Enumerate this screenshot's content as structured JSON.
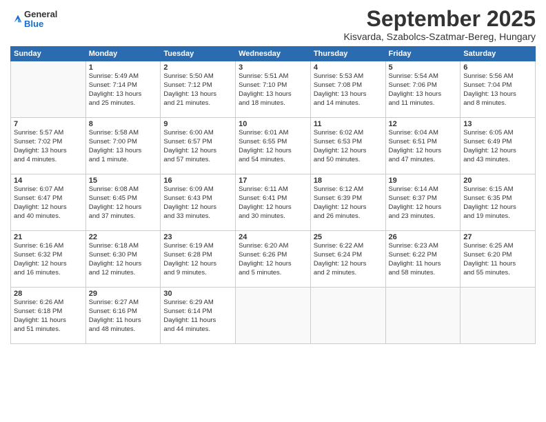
{
  "logo": {
    "general": "General",
    "blue": "Blue"
  },
  "title": "September 2025",
  "location": "Kisvarda, Szabolcs-Szatmar-Bereg, Hungary",
  "headers": [
    "Sunday",
    "Monday",
    "Tuesday",
    "Wednesday",
    "Thursday",
    "Friday",
    "Saturday"
  ],
  "weeks": [
    [
      {
        "day": "",
        "info": ""
      },
      {
        "day": "1",
        "info": "Sunrise: 5:49 AM\nSunset: 7:14 PM\nDaylight: 13 hours\nand 25 minutes."
      },
      {
        "day": "2",
        "info": "Sunrise: 5:50 AM\nSunset: 7:12 PM\nDaylight: 13 hours\nand 21 minutes."
      },
      {
        "day": "3",
        "info": "Sunrise: 5:51 AM\nSunset: 7:10 PM\nDaylight: 13 hours\nand 18 minutes."
      },
      {
        "day": "4",
        "info": "Sunrise: 5:53 AM\nSunset: 7:08 PM\nDaylight: 13 hours\nand 14 minutes."
      },
      {
        "day": "5",
        "info": "Sunrise: 5:54 AM\nSunset: 7:06 PM\nDaylight: 13 hours\nand 11 minutes."
      },
      {
        "day": "6",
        "info": "Sunrise: 5:56 AM\nSunset: 7:04 PM\nDaylight: 13 hours\nand 8 minutes."
      }
    ],
    [
      {
        "day": "7",
        "info": "Sunrise: 5:57 AM\nSunset: 7:02 PM\nDaylight: 13 hours\nand 4 minutes."
      },
      {
        "day": "8",
        "info": "Sunrise: 5:58 AM\nSunset: 7:00 PM\nDaylight: 13 hours\nand 1 minute."
      },
      {
        "day": "9",
        "info": "Sunrise: 6:00 AM\nSunset: 6:57 PM\nDaylight: 12 hours\nand 57 minutes."
      },
      {
        "day": "10",
        "info": "Sunrise: 6:01 AM\nSunset: 6:55 PM\nDaylight: 12 hours\nand 54 minutes."
      },
      {
        "day": "11",
        "info": "Sunrise: 6:02 AM\nSunset: 6:53 PM\nDaylight: 12 hours\nand 50 minutes."
      },
      {
        "day": "12",
        "info": "Sunrise: 6:04 AM\nSunset: 6:51 PM\nDaylight: 12 hours\nand 47 minutes."
      },
      {
        "day": "13",
        "info": "Sunrise: 6:05 AM\nSunset: 6:49 PM\nDaylight: 12 hours\nand 43 minutes."
      }
    ],
    [
      {
        "day": "14",
        "info": "Sunrise: 6:07 AM\nSunset: 6:47 PM\nDaylight: 12 hours\nand 40 minutes."
      },
      {
        "day": "15",
        "info": "Sunrise: 6:08 AM\nSunset: 6:45 PM\nDaylight: 12 hours\nand 37 minutes."
      },
      {
        "day": "16",
        "info": "Sunrise: 6:09 AM\nSunset: 6:43 PM\nDaylight: 12 hours\nand 33 minutes."
      },
      {
        "day": "17",
        "info": "Sunrise: 6:11 AM\nSunset: 6:41 PM\nDaylight: 12 hours\nand 30 minutes."
      },
      {
        "day": "18",
        "info": "Sunrise: 6:12 AM\nSunset: 6:39 PM\nDaylight: 12 hours\nand 26 minutes."
      },
      {
        "day": "19",
        "info": "Sunrise: 6:14 AM\nSunset: 6:37 PM\nDaylight: 12 hours\nand 23 minutes."
      },
      {
        "day": "20",
        "info": "Sunrise: 6:15 AM\nSunset: 6:35 PM\nDaylight: 12 hours\nand 19 minutes."
      }
    ],
    [
      {
        "day": "21",
        "info": "Sunrise: 6:16 AM\nSunset: 6:32 PM\nDaylight: 12 hours\nand 16 minutes."
      },
      {
        "day": "22",
        "info": "Sunrise: 6:18 AM\nSunset: 6:30 PM\nDaylight: 12 hours\nand 12 minutes."
      },
      {
        "day": "23",
        "info": "Sunrise: 6:19 AM\nSunset: 6:28 PM\nDaylight: 12 hours\nand 9 minutes."
      },
      {
        "day": "24",
        "info": "Sunrise: 6:20 AM\nSunset: 6:26 PM\nDaylight: 12 hours\nand 5 minutes."
      },
      {
        "day": "25",
        "info": "Sunrise: 6:22 AM\nSunset: 6:24 PM\nDaylight: 12 hours\nand 2 minutes."
      },
      {
        "day": "26",
        "info": "Sunrise: 6:23 AM\nSunset: 6:22 PM\nDaylight: 11 hours\nand 58 minutes."
      },
      {
        "day": "27",
        "info": "Sunrise: 6:25 AM\nSunset: 6:20 PM\nDaylight: 11 hours\nand 55 minutes."
      }
    ],
    [
      {
        "day": "28",
        "info": "Sunrise: 6:26 AM\nSunset: 6:18 PM\nDaylight: 11 hours\nand 51 minutes."
      },
      {
        "day": "29",
        "info": "Sunrise: 6:27 AM\nSunset: 6:16 PM\nDaylight: 11 hours\nand 48 minutes."
      },
      {
        "day": "30",
        "info": "Sunrise: 6:29 AM\nSunset: 6:14 PM\nDaylight: 11 hours\nand 44 minutes."
      },
      {
        "day": "",
        "info": ""
      },
      {
        "day": "",
        "info": ""
      },
      {
        "day": "",
        "info": ""
      },
      {
        "day": "",
        "info": ""
      }
    ]
  ]
}
